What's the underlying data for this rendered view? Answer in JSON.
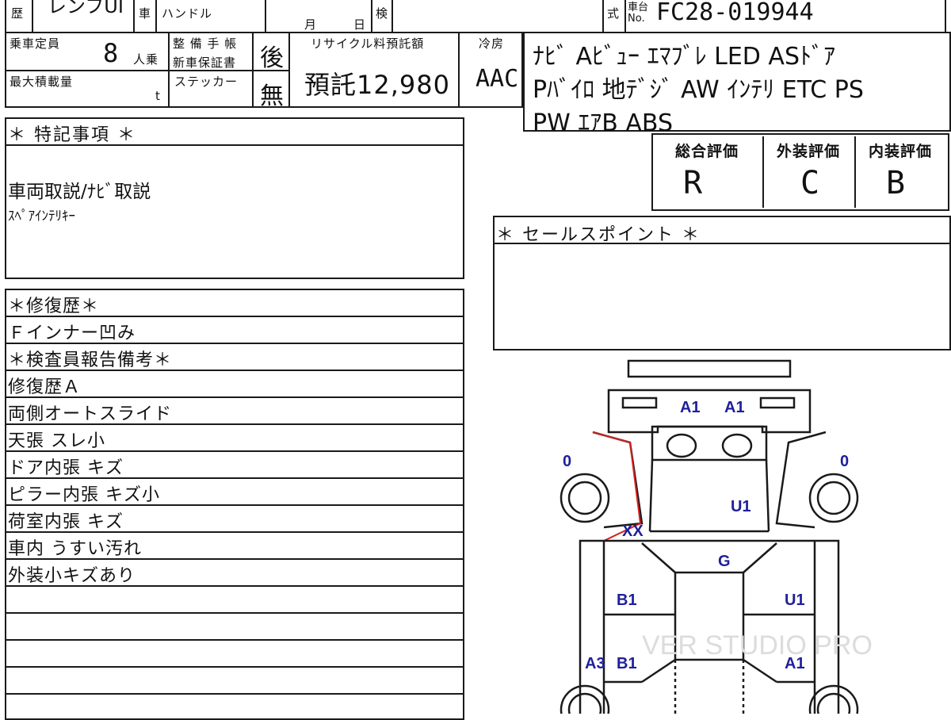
{
  "header": {
    "model_partial": "レンフUI",
    "cell_reki": "歴",
    "cell_kuruma": "車",
    "handle_label": "ハンドル",
    "month_label": "月",
    "day_label": "日",
    "inspection_label": "検",
    "shiki_label": "式",
    "chassis_label_top": "車台",
    "chassis_label_no": "No.",
    "chassis_number": "FC28-019944"
  },
  "specs": {
    "capacity_label": "乗車定員",
    "capacity_value": "8",
    "capacity_unit": "人乗",
    "load_label": "最大積載量",
    "load_unit": "t",
    "maintenance_label": "整 備 手 帳",
    "warranty_label": "新車保証書",
    "maintenance_value": "後",
    "sticker_label": "ステッカー",
    "sticker_value": "無",
    "recycle_label": "リサイクル料預託額",
    "recycle_value": "預託12,980",
    "ac_label": "冷房",
    "ac_value": "AAC"
  },
  "equipment": {
    "line1": "ﾅﾋﾞ Aﾋﾞｭｰ ｴﾏﾌﾞﾚ LED ASﾄﾞｱ",
    "line2": "Pﾊﾞｲﾛ 地ﾃﾞｼﾞ AW ｲﾝﾃﾘ ETC PS",
    "line3": "PW ｴｱB ABS"
  },
  "special_notes": {
    "title": "＊ 特記事項 ＊",
    "line1": "車両取説/ﾅﾋﾞ取説",
    "line2": "ｽﾍﾟｱｲﾝﾃﾘｷｰ"
  },
  "grades": {
    "overall_label": "総合評価",
    "overall_value": "R",
    "exterior_label": "外装評価",
    "exterior_value": "C",
    "interior_label": "内装評価",
    "interior_value": "B"
  },
  "sales_point": {
    "title": "＊ セールスポイント ＊"
  },
  "repair": {
    "title": "＊修復歴＊",
    "detail": "Ｆインナー凹み"
  },
  "inspector": {
    "title": "＊検査員報告備考＊",
    "notes": [
      "修復歴Ａ",
      "両側オートスライド",
      "天張 スレ小",
      "ドア内張 キズ",
      "ピラー内張 キズ小",
      "荷室内張 キズ",
      "車内 うすい汚れ",
      "外装小キズあり"
    ]
  },
  "diagram": {
    "marks": {
      "front_left": "A1",
      "front_right": "A1",
      "wheel_fl": "0",
      "wheel_fr": "0",
      "hood_right": "U1",
      "left_frame": "XX",
      "roof": "G",
      "left_door1": "B1",
      "right_door1": "U1",
      "left_rear_a": "A3",
      "left_rear_b": "B1",
      "right_rear": "A1"
    },
    "watermark": "VER STUDIO PRO",
    "mark_color": "#1f1f9c",
    "repair_color": "#d62020"
  }
}
